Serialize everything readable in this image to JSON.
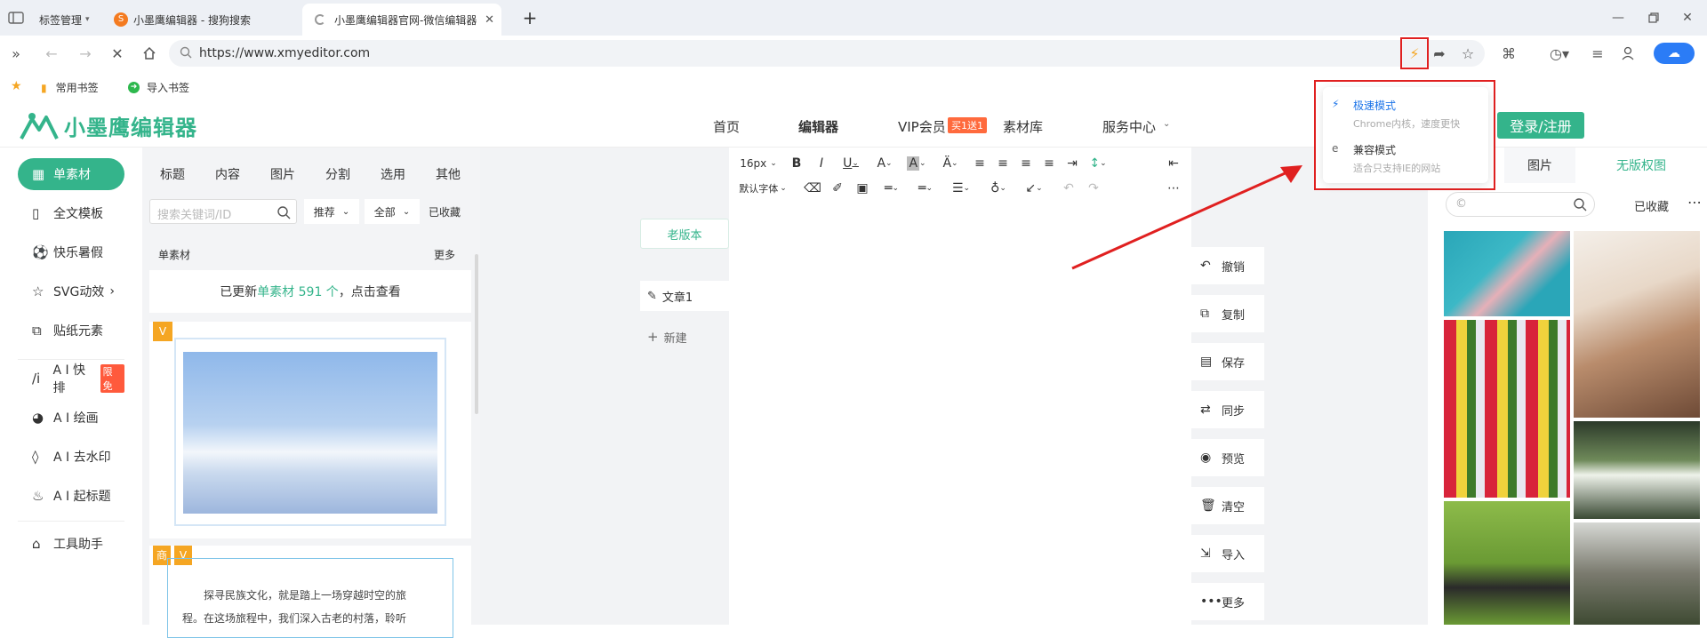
{
  "browser": {
    "tabs": [
      {
        "label": "标签管理"
      },
      {
        "label": "小墨鹰编辑器 - 搜狗搜索"
      },
      {
        "label": "小墨鹰编辑器官网-微信编辑器"
      }
    ],
    "url": "https://www.xmyeditor.com",
    "bookmarks": [
      {
        "label": "常用书签"
      },
      {
        "label": "导入书签"
      }
    ],
    "accent": "#1a73e8",
    "highlight": "#e02020"
  },
  "speed_menu": {
    "items": [
      {
        "title": "极速模式",
        "subtitle": "Chrome内核，速度更快"
      },
      {
        "title": "兼容模式",
        "subtitle": "适合只支持IE的网站"
      }
    ]
  },
  "site": {
    "logo_text": "小墨鹰编辑器",
    "brand_color": "#34b48b",
    "nav": [
      {
        "label": "首页"
      },
      {
        "label": "编辑器"
      },
      {
        "label": "VIP会员"
      },
      {
        "label": "素材库"
      },
      {
        "label": "服务中心"
      }
    ],
    "vip_badge": "买1送1",
    "login_label": "登录/注册"
  },
  "leftnav": {
    "items": [
      {
        "label": "单素材",
        "icon": "grid-icon"
      },
      {
        "label": "全文模板",
        "icon": "template-icon"
      },
      {
        "label": "快乐暑假",
        "icon": "ball-icon"
      },
      {
        "label": "SVG动效",
        "icon": "star-icon"
      },
      {
        "label": "贴纸元素",
        "icon": "sticker-icon"
      },
      {
        "label": "A I 快排",
        "icon": "ai-icon",
        "badge": "限免"
      },
      {
        "label": "A I 绘画",
        "icon": "palette-icon"
      },
      {
        "label": "A I 去水印",
        "icon": "drop-icon"
      },
      {
        "label": "A I 起标题",
        "icon": "fire-icon"
      },
      {
        "label": "工具助手",
        "icon": "tool-icon"
      }
    ]
  },
  "material": {
    "tabs": [
      "标题",
      "内容",
      "图片",
      "分割",
      "选用",
      "其他"
    ],
    "search_placeholder": "搜索关键词/ID",
    "filter1": "推荐",
    "filter2": "全部",
    "collected": "已收藏",
    "section_title": "单素材",
    "more": "更多",
    "notice_prefix": "已更新",
    "notice_highlight": "单素材 591 个",
    "notice_suffix": "，点击查看",
    "card_text_line1": "探寻民族文化，就是踏上一场穿越时空的旅",
    "card_text_line2": "程。在这场旅程中，我们深入古老的村落，聆听"
  },
  "workspace": {
    "old_version": "老版本",
    "article": "文章1",
    "new_label": "新建"
  },
  "editor": {
    "font_size": "16px",
    "font_family": "默认字体"
  },
  "side_actions": [
    {
      "label": "撤销",
      "icon": "undo-icon"
    },
    {
      "label": "复制",
      "icon": "copy-icon"
    },
    {
      "label": "保存",
      "icon": "save-icon"
    },
    {
      "label": "同步",
      "icon": "sync-icon"
    },
    {
      "label": "预览",
      "icon": "eye-icon"
    },
    {
      "label": "清空",
      "icon": "trash-icon"
    },
    {
      "label": "导入",
      "icon": "import-icon"
    },
    {
      "label": "更多",
      "icon": "more-icon"
    }
  ],
  "rightpanel": {
    "tab1": "图片",
    "tab2": "无版权图",
    "search_placeholder": "©",
    "collected": "已收藏"
  }
}
